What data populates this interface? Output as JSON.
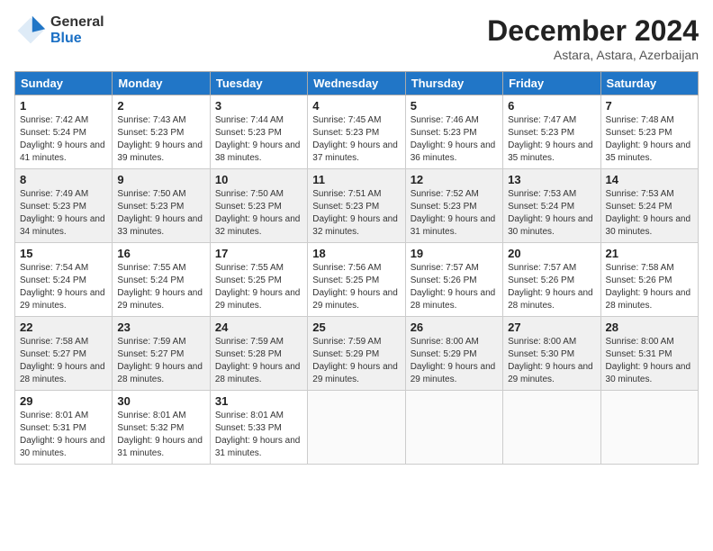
{
  "logo": {
    "general": "General",
    "blue": "Blue"
  },
  "header": {
    "month": "December 2024",
    "location": "Astara, Astara, Azerbaijan"
  },
  "weekdays": [
    "Sunday",
    "Monday",
    "Tuesday",
    "Wednesday",
    "Thursday",
    "Friday",
    "Saturday"
  ],
  "weeks": [
    [
      {
        "day": "1",
        "sunrise": "7:42 AM",
        "sunset": "5:24 PM",
        "daylight": "9 hours and 41 minutes."
      },
      {
        "day": "2",
        "sunrise": "7:43 AM",
        "sunset": "5:23 PM",
        "daylight": "9 hours and 39 minutes."
      },
      {
        "day": "3",
        "sunrise": "7:44 AM",
        "sunset": "5:23 PM",
        "daylight": "9 hours and 38 minutes."
      },
      {
        "day": "4",
        "sunrise": "7:45 AM",
        "sunset": "5:23 PM",
        "daylight": "9 hours and 37 minutes."
      },
      {
        "day": "5",
        "sunrise": "7:46 AM",
        "sunset": "5:23 PM",
        "daylight": "9 hours and 36 minutes."
      },
      {
        "day": "6",
        "sunrise": "7:47 AM",
        "sunset": "5:23 PM",
        "daylight": "9 hours and 35 minutes."
      },
      {
        "day": "7",
        "sunrise": "7:48 AM",
        "sunset": "5:23 PM",
        "daylight": "9 hours and 35 minutes."
      }
    ],
    [
      {
        "day": "8",
        "sunrise": "7:49 AM",
        "sunset": "5:23 PM",
        "daylight": "9 hours and 34 minutes."
      },
      {
        "day": "9",
        "sunrise": "7:50 AM",
        "sunset": "5:23 PM",
        "daylight": "9 hours and 33 minutes."
      },
      {
        "day": "10",
        "sunrise": "7:50 AM",
        "sunset": "5:23 PM",
        "daylight": "9 hours and 32 minutes."
      },
      {
        "day": "11",
        "sunrise": "7:51 AM",
        "sunset": "5:23 PM",
        "daylight": "9 hours and 32 minutes."
      },
      {
        "day": "12",
        "sunrise": "7:52 AM",
        "sunset": "5:23 PM",
        "daylight": "9 hours and 31 minutes."
      },
      {
        "day": "13",
        "sunrise": "7:53 AM",
        "sunset": "5:24 PM",
        "daylight": "9 hours and 30 minutes."
      },
      {
        "day": "14",
        "sunrise": "7:53 AM",
        "sunset": "5:24 PM",
        "daylight": "9 hours and 30 minutes."
      }
    ],
    [
      {
        "day": "15",
        "sunrise": "7:54 AM",
        "sunset": "5:24 PM",
        "daylight": "9 hours and 29 minutes."
      },
      {
        "day": "16",
        "sunrise": "7:55 AM",
        "sunset": "5:24 PM",
        "daylight": "9 hours and 29 minutes."
      },
      {
        "day": "17",
        "sunrise": "7:55 AM",
        "sunset": "5:25 PM",
        "daylight": "9 hours and 29 minutes."
      },
      {
        "day": "18",
        "sunrise": "7:56 AM",
        "sunset": "5:25 PM",
        "daylight": "9 hours and 29 minutes."
      },
      {
        "day": "19",
        "sunrise": "7:57 AM",
        "sunset": "5:26 PM",
        "daylight": "9 hours and 28 minutes."
      },
      {
        "day": "20",
        "sunrise": "7:57 AM",
        "sunset": "5:26 PM",
        "daylight": "9 hours and 28 minutes."
      },
      {
        "day": "21",
        "sunrise": "7:58 AM",
        "sunset": "5:26 PM",
        "daylight": "9 hours and 28 minutes."
      }
    ],
    [
      {
        "day": "22",
        "sunrise": "7:58 AM",
        "sunset": "5:27 PM",
        "daylight": "9 hours and 28 minutes."
      },
      {
        "day": "23",
        "sunrise": "7:59 AM",
        "sunset": "5:27 PM",
        "daylight": "9 hours and 28 minutes."
      },
      {
        "day": "24",
        "sunrise": "7:59 AM",
        "sunset": "5:28 PM",
        "daylight": "9 hours and 28 minutes."
      },
      {
        "day": "25",
        "sunrise": "7:59 AM",
        "sunset": "5:29 PM",
        "daylight": "9 hours and 29 minutes."
      },
      {
        "day": "26",
        "sunrise": "8:00 AM",
        "sunset": "5:29 PM",
        "daylight": "9 hours and 29 minutes."
      },
      {
        "day": "27",
        "sunrise": "8:00 AM",
        "sunset": "5:30 PM",
        "daylight": "9 hours and 29 minutes."
      },
      {
        "day": "28",
        "sunrise": "8:00 AM",
        "sunset": "5:31 PM",
        "daylight": "9 hours and 30 minutes."
      }
    ],
    [
      {
        "day": "29",
        "sunrise": "8:01 AM",
        "sunset": "5:31 PM",
        "daylight": "9 hours and 30 minutes."
      },
      {
        "day": "30",
        "sunrise": "8:01 AM",
        "sunset": "5:32 PM",
        "daylight": "9 hours and 31 minutes."
      },
      {
        "day": "31",
        "sunrise": "8:01 AM",
        "sunset": "5:33 PM",
        "daylight": "9 hours and 31 minutes."
      },
      null,
      null,
      null,
      null
    ]
  ]
}
